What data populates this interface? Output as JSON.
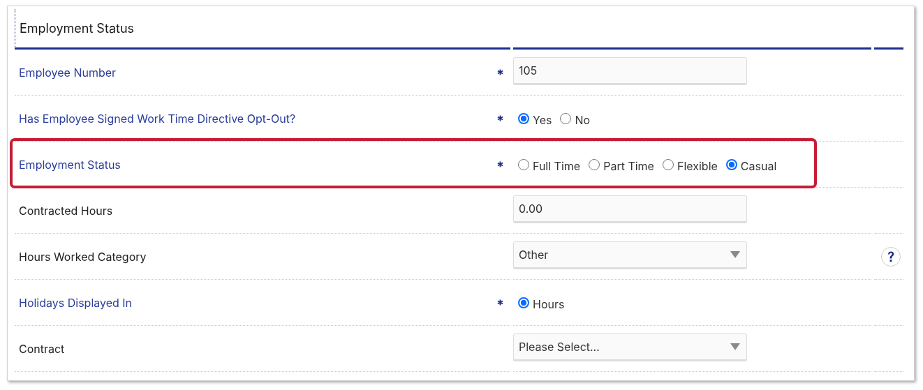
{
  "section": {
    "title": "Employment Status"
  },
  "rows": [
    {
      "kind": "text",
      "label": "Employee Number",
      "required": true,
      "value": "105"
    },
    {
      "kind": "radio",
      "label": "Has Employee Signed Work Time Directive Opt-Out?",
      "required": true,
      "options": [
        {
          "label": "Yes",
          "selected": true
        },
        {
          "label": "No",
          "selected": false
        }
      ]
    },
    {
      "kind": "radio",
      "label": "Employment Status",
      "required": true,
      "highlighted": true,
      "options": [
        {
          "label": "Full Time",
          "selected": false
        },
        {
          "label": "Part Time",
          "selected": false
        },
        {
          "label": "Flexible",
          "selected": false
        },
        {
          "label": "Casual",
          "selected": true
        }
      ]
    },
    {
      "kind": "text",
      "label": "Contracted Hours",
      "required": false,
      "value": "0.00"
    },
    {
      "kind": "select",
      "label": "Hours Worked Category",
      "required": false,
      "value": "Other",
      "help": true
    },
    {
      "kind": "radio",
      "label": "Holidays Displayed In",
      "required": true,
      "options": [
        {
          "label": "Hours",
          "selected": true
        }
      ]
    },
    {
      "kind": "select",
      "label": "Contract",
      "required": false,
      "value": "Please Select..."
    }
  ]
}
